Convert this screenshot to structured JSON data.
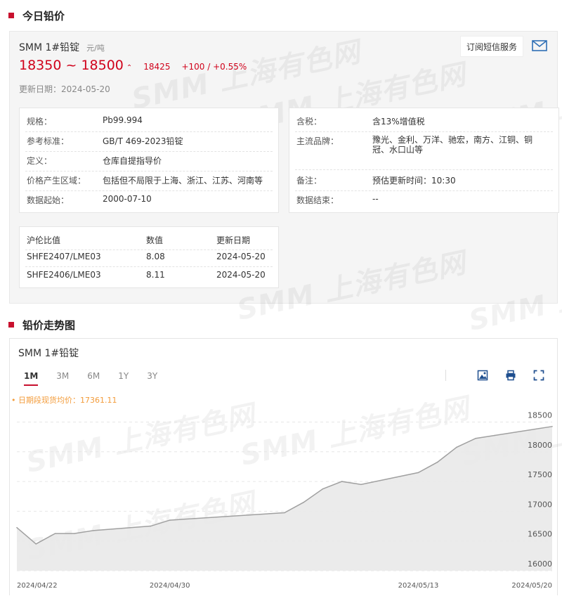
{
  "today": {
    "section_title": "今日铅价",
    "product": "SMM 1#铅锭",
    "unit": "元/吨",
    "price_range": "18350 ~ 18500",
    "avg": "18425",
    "change": "+100 / +0.55%",
    "update_date": "更新日期：2024-05-20",
    "subscribe_label": "订阅短信服务",
    "watermark": "SMM 上海有色网",
    "specs_left": [
      {
        "k": "规格：",
        "v": "Pb99.994"
      },
      {
        "k": "参考标准：",
        "v": "GB/T 469-2023铅锭"
      },
      {
        "k": "定义：",
        "v": "仓库自提指导价"
      },
      {
        "k": "价格产生区域：",
        "v": "包括但不局限于上海、浙江、江苏、河南等"
      },
      {
        "k": "数据起始：",
        "v": "2000-07-10"
      }
    ],
    "specs_right": [
      {
        "k": "含税：",
        "v": "含13%增值税"
      },
      {
        "k": "主流品牌：",
        "v": "豫光、金利、万洋、驰宏，南方、江铜、铜冠、水口山等"
      },
      {
        "k": "备注：",
        "v": "预估更新时间：10:30"
      },
      {
        "k": "数据结束：",
        "v": "--"
      }
    ],
    "ratio_table": {
      "headers": [
        "沪伦比值",
        "数值",
        "更新日期"
      ],
      "rows": [
        [
          "SHFE2407/LME03",
          "8.08",
          "2024-05-20"
        ],
        [
          "SHFE2406/LME03",
          "8.11",
          "2024-05-20"
        ]
      ]
    }
  },
  "trend": {
    "section_title": "铅价走势图",
    "chart_title": "SMM 1#铅锭",
    "tabs": [
      "1M",
      "3M",
      "6M",
      "1Y",
      "3Y"
    ],
    "active_tab": "1M",
    "avg_label": "• 日期段现货均价：17361.11",
    "icons": [
      "image-download-icon",
      "print-icon",
      "fullscreen-icon"
    ]
  },
  "chart_data": {
    "type": "area",
    "title": "SMM 1#铅锭",
    "x": [
      "2024-04-22",
      "2024-04-23",
      "2024-04-24",
      "2024-04-25",
      "2024-04-26",
      "2024-04-29",
      "2024-04-30",
      "2024-05-06",
      "2024-05-07",
      "2024-05-08",
      "2024-05-09",
      "2024-05-10",
      "2024-05-13",
      "2024-05-14",
      "2024-05-15",
      "2024-05-16",
      "2024-05-17",
      "2024-05-20"
    ],
    "values": [
      16725,
      16450,
      16625,
      16625,
      16675,
      16750,
      16850,
      16975,
      17150,
      17375,
      17500,
      17450,
      17650,
      17825,
      18075,
      18225,
      18275,
      18425
    ],
    "x_tick_labels": [
      "2024/04/22",
      "2024/04/30",
      "2024/05/13",
      "2024/05/20"
    ],
    "y_ticks": [
      16000,
      16500,
      17000,
      17500,
      18000,
      18500
    ],
    "ylim": [
      16000,
      18600
    ],
    "grid": true,
    "fill_color": "#e9e9e9",
    "line_color": "#a0a0a0"
  },
  "colors": {
    "accent": "#c8102e",
    "price": "#d0021b",
    "avg_label": "#f39c3b"
  }
}
